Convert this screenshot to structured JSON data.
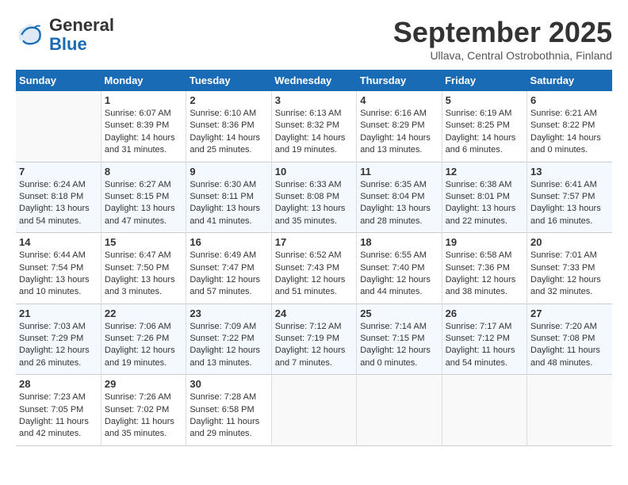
{
  "header": {
    "logo_line1": "General",
    "logo_line2": "Blue",
    "month": "September 2025",
    "location": "Ullava, Central Ostrobothnia, Finland"
  },
  "columns": [
    "Sunday",
    "Monday",
    "Tuesday",
    "Wednesday",
    "Thursday",
    "Friday",
    "Saturday"
  ],
  "weeks": [
    [
      {
        "day": "",
        "info": ""
      },
      {
        "day": "1",
        "info": "Sunrise: 6:07 AM\nSunset: 8:39 PM\nDaylight: 14 hours\nand 31 minutes."
      },
      {
        "day": "2",
        "info": "Sunrise: 6:10 AM\nSunset: 8:36 PM\nDaylight: 14 hours\nand 25 minutes."
      },
      {
        "day": "3",
        "info": "Sunrise: 6:13 AM\nSunset: 8:32 PM\nDaylight: 14 hours\nand 19 minutes."
      },
      {
        "day": "4",
        "info": "Sunrise: 6:16 AM\nSunset: 8:29 PM\nDaylight: 14 hours\nand 13 minutes."
      },
      {
        "day": "5",
        "info": "Sunrise: 6:19 AM\nSunset: 8:25 PM\nDaylight: 14 hours\nand 6 minutes."
      },
      {
        "day": "6",
        "info": "Sunrise: 6:21 AM\nSunset: 8:22 PM\nDaylight: 14 hours\nand 0 minutes."
      }
    ],
    [
      {
        "day": "7",
        "info": "Sunrise: 6:24 AM\nSunset: 8:18 PM\nDaylight: 13 hours\nand 54 minutes."
      },
      {
        "day": "8",
        "info": "Sunrise: 6:27 AM\nSunset: 8:15 PM\nDaylight: 13 hours\nand 47 minutes."
      },
      {
        "day": "9",
        "info": "Sunrise: 6:30 AM\nSunset: 8:11 PM\nDaylight: 13 hours\nand 41 minutes."
      },
      {
        "day": "10",
        "info": "Sunrise: 6:33 AM\nSunset: 8:08 PM\nDaylight: 13 hours\nand 35 minutes."
      },
      {
        "day": "11",
        "info": "Sunrise: 6:35 AM\nSunset: 8:04 PM\nDaylight: 13 hours\nand 28 minutes."
      },
      {
        "day": "12",
        "info": "Sunrise: 6:38 AM\nSunset: 8:01 PM\nDaylight: 13 hours\nand 22 minutes."
      },
      {
        "day": "13",
        "info": "Sunrise: 6:41 AM\nSunset: 7:57 PM\nDaylight: 13 hours\nand 16 minutes."
      }
    ],
    [
      {
        "day": "14",
        "info": "Sunrise: 6:44 AM\nSunset: 7:54 PM\nDaylight: 13 hours\nand 10 minutes."
      },
      {
        "day": "15",
        "info": "Sunrise: 6:47 AM\nSunset: 7:50 PM\nDaylight: 13 hours\nand 3 minutes."
      },
      {
        "day": "16",
        "info": "Sunrise: 6:49 AM\nSunset: 7:47 PM\nDaylight: 12 hours\nand 57 minutes."
      },
      {
        "day": "17",
        "info": "Sunrise: 6:52 AM\nSunset: 7:43 PM\nDaylight: 12 hours\nand 51 minutes."
      },
      {
        "day": "18",
        "info": "Sunrise: 6:55 AM\nSunset: 7:40 PM\nDaylight: 12 hours\nand 44 minutes."
      },
      {
        "day": "19",
        "info": "Sunrise: 6:58 AM\nSunset: 7:36 PM\nDaylight: 12 hours\nand 38 minutes."
      },
      {
        "day": "20",
        "info": "Sunrise: 7:01 AM\nSunset: 7:33 PM\nDaylight: 12 hours\nand 32 minutes."
      }
    ],
    [
      {
        "day": "21",
        "info": "Sunrise: 7:03 AM\nSunset: 7:29 PM\nDaylight: 12 hours\nand 26 minutes."
      },
      {
        "day": "22",
        "info": "Sunrise: 7:06 AM\nSunset: 7:26 PM\nDaylight: 12 hours\nand 19 minutes."
      },
      {
        "day": "23",
        "info": "Sunrise: 7:09 AM\nSunset: 7:22 PM\nDaylight: 12 hours\nand 13 minutes."
      },
      {
        "day": "24",
        "info": "Sunrise: 7:12 AM\nSunset: 7:19 PM\nDaylight: 12 hours\nand 7 minutes."
      },
      {
        "day": "25",
        "info": "Sunrise: 7:14 AM\nSunset: 7:15 PM\nDaylight: 12 hours\nand 0 minutes."
      },
      {
        "day": "26",
        "info": "Sunrise: 7:17 AM\nSunset: 7:12 PM\nDaylight: 11 hours\nand 54 minutes."
      },
      {
        "day": "27",
        "info": "Sunrise: 7:20 AM\nSunset: 7:08 PM\nDaylight: 11 hours\nand 48 minutes."
      }
    ],
    [
      {
        "day": "28",
        "info": "Sunrise: 7:23 AM\nSunset: 7:05 PM\nDaylight: 11 hours\nand 42 minutes."
      },
      {
        "day": "29",
        "info": "Sunrise: 7:26 AM\nSunset: 7:02 PM\nDaylight: 11 hours\nand 35 minutes."
      },
      {
        "day": "30",
        "info": "Sunrise: 7:28 AM\nSunset: 6:58 PM\nDaylight: 11 hours\nand 29 minutes."
      },
      {
        "day": "",
        "info": ""
      },
      {
        "day": "",
        "info": ""
      },
      {
        "day": "",
        "info": ""
      },
      {
        "day": "",
        "info": ""
      }
    ]
  ]
}
